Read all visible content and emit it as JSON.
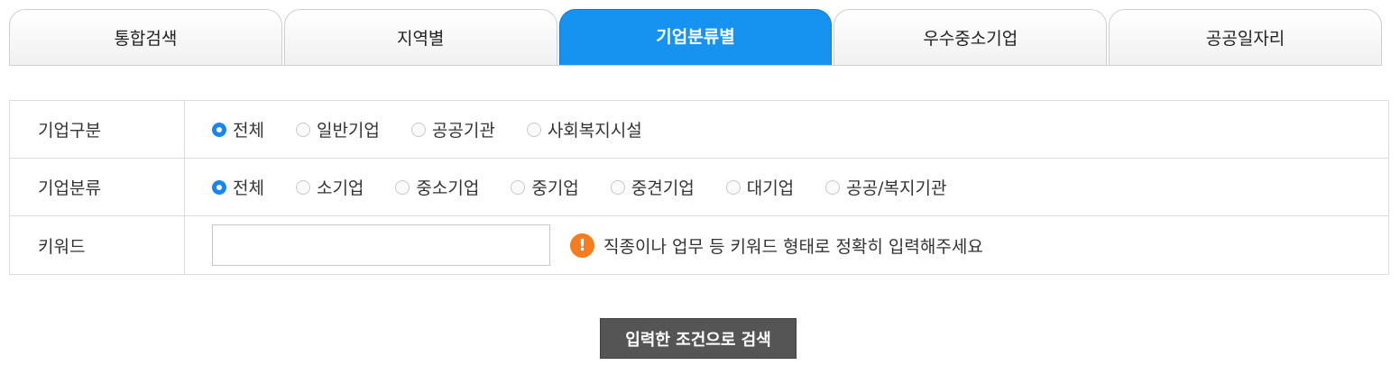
{
  "tabs": [
    {
      "label": "통합검색",
      "active": false
    },
    {
      "label": "지역별",
      "active": false
    },
    {
      "label": "기업분류별",
      "active": true
    },
    {
      "label": "우수중소기업",
      "active": false
    },
    {
      "label": "공공일자리",
      "active": false
    }
  ],
  "filters": {
    "company_type": {
      "label": "기업구분",
      "options": [
        {
          "label": "전체",
          "checked": true
        },
        {
          "label": "일반기업",
          "checked": false
        },
        {
          "label": "공공기관",
          "checked": false
        },
        {
          "label": "사회복지시설",
          "checked": false
        }
      ]
    },
    "company_class": {
      "label": "기업분류",
      "options": [
        {
          "label": "전체",
          "checked": true
        },
        {
          "label": "소기업",
          "checked": false
        },
        {
          "label": "중소기업",
          "checked": false
        },
        {
          "label": "중기업",
          "checked": false
        },
        {
          "label": "중견기업",
          "checked": false
        },
        {
          "label": "대기업",
          "checked": false
        },
        {
          "label": "공공/복지기관",
          "checked": false
        }
      ]
    },
    "keyword": {
      "label": "키워드",
      "value": "",
      "hint": "직종이나 업무 등 키워드 형태로 정확히 입력해주세요",
      "hint_icon": "exclamation-icon"
    }
  },
  "search_button_label": "입력한 조건으로 검색",
  "colors": {
    "active_tab": "#1692f0",
    "radio_checked": "#1a84f0",
    "warning": "#f57c1f",
    "button": "#555555"
  }
}
